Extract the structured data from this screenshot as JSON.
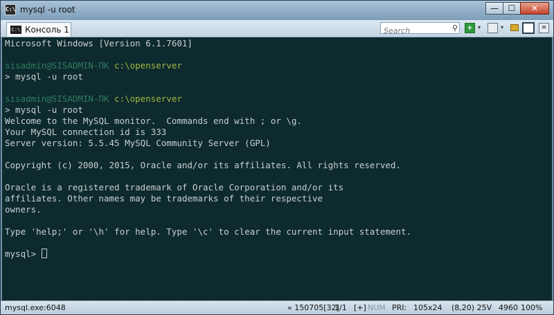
{
  "window": {
    "title": "mysql  -u root",
    "app_icon": "C:\\",
    "buttons": {
      "minimize": "—",
      "maximize": "☐",
      "close": "✕"
    }
  },
  "toolbar": {
    "tab_label": "Консоль 1",
    "tab_icon_text": "C:\\",
    "search_placeholder": "Search",
    "icons": [
      "search-icon",
      "add-console-icon",
      "dropdown-icon",
      "console-view-icon",
      "lock-icon",
      "window-toggle-icon",
      "menu-icon"
    ]
  },
  "terminal": {
    "line01": "Microsoft Windows [Version 6.1.7601]",
    "prompt1_user": "sisadmin@SISADMIN-ПК",
    "prompt1_path": "c:\\openserver",
    "line04": "> mysql -u root",
    "prompt2_user": "sisadmin@SISADMIN-ПК",
    "prompt2_path": "c:\\openserver",
    "line07": "> mysql -u root",
    "line08": "Welcome to the MySQL monitor.  Commands end with ; or \\g.",
    "line09": "Your MySQL connection id is 333",
    "line10": "Server version: 5.5.45 MySQL Community Server (GPL)",
    "line12": "Copyright (c) 2000, 2015, Oracle and/or its affiliates. All rights reserved.",
    "line14": "Oracle is a registered trademark of Oracle Corporation and/or its",
    "line15": "affiliates. Other names may be trademarks of their respective",
    "line16": "owners.",
    "line18": "Type 'help;' or '\\h' for help. Type '\\c' to clear the current input statement.",
    "prompt_mysql": "mysql> "
  },
  "statusbar": {
    "process": "mysql.exe:6048",
    "position": "« 150705[32]",
    "page": "1/1",
    "mode": "[+]",
    "num": "NUM",
    "pri": "PRI:",
    "size": "105x24",
    "cursor": "(8,20) 25V",
    "pid": "4960",
    "zoom": "100%"
  },
  "colors": {
    "background": "#0d2a2e",
    "text": "#c8d0d0",
    "prompt_user": "#2f7d60",
    "prompt_path": "#9eb840"
  }
}
